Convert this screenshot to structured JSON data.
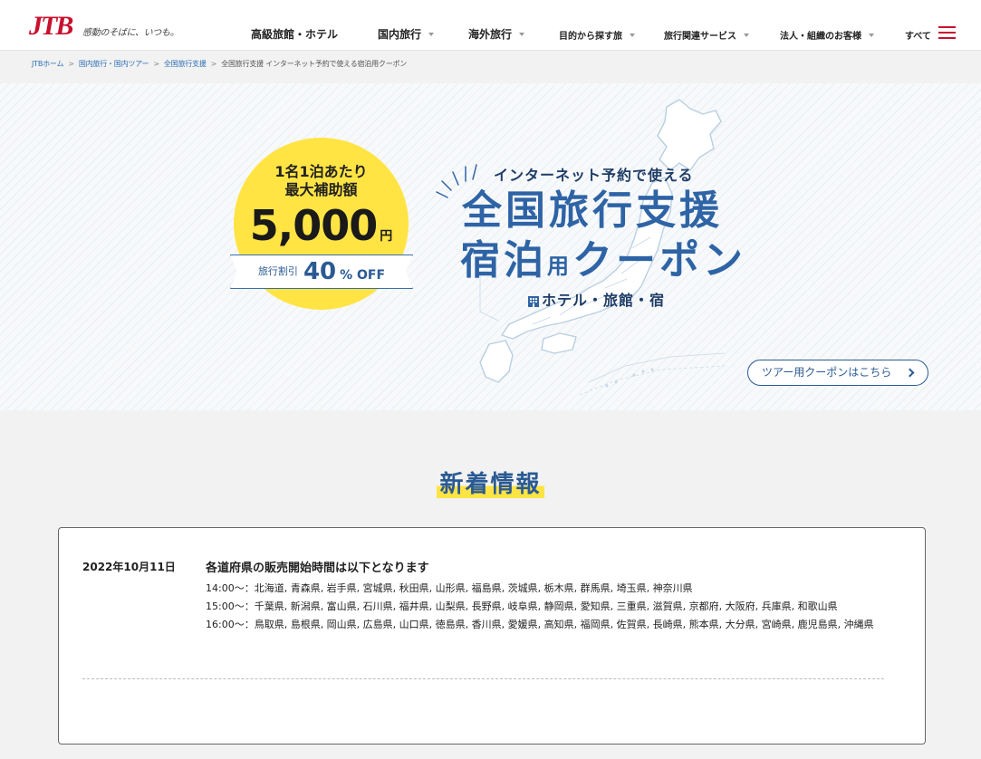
{
  "header": {
    "logo": "JTB",
    "tagline": "感動のそばに、いつも。",
    "nav": [
      {
        "label": "高級旅館・ホテル"
      },
      {
        "label": "国内旅行"
      },
      {
        "label": "海外旅行"
      },
      {
        "label": "目的から探す旅"
      },
      {
        "label": "旅行関連サービス"
      },
      {
        "label": "法人・組織のお客様"
      },
      {
        "label": "すべて"
      }
    ]
  },
  "breadcrumb": [
    "JTBホーム",
    "国内旅行・国内ツアー",
    "全国旅行支援",
    "全国旅行支援 インターネット予約で使える宿泊用クーポン"
  ],
  "hero": {
    "badge": {
      "line1": "1名1泊あたり",
      "line2": "最大補助額",
      "amount": "5,000",
      "currency": "円",
      "discount_label": "旅行割引",
      "discount_value": "40",
      "discount_unit": "% OFF"
    },
    "subtitle": "インターネット予約で使える",
    "title_line1": "全国旅行支援",
    "title_line2_a": "宿泊",
    "title_line2_b": "用",
    "title_line2_c": "クーポン",
    "hotels_label": "ホテル・旅館・宿",
    "tour_coupon_button": "ツアー用クーポンはこちら"
  },
  "news": {
    "heading": "新着情報",
    "items": [
      {
        "date": "2022年10月11日",
        "title": "各道府県の販売開始時間は以下となります",
        "lines": [
          "14:00〜：北海道, 青森県, 岩手県, 宮城県, 秋田県, 山形県, 福島県, 茨城県, 栃木県, 群馬県, 埼玉県, 神奈川県",
          "15:00〜：千葉県, 新潟県, 富山県, 石川県, 福井県, 山梨県, 長野県, 岐阜県, 静岡県, 愛知県, 三重県, 滋賀県, 京都府, 大阪府, 兵庫県, 和歌山県",
          "16:00〜：鳥取県, 島根県, 岡山県, 広島県, 山口県, 徳島県, 香川県, 愛媛県, 高知県, 福岡県, 佐賀県, 長崎県, 熊本県, 大分県, 宮崎県, 鹿児島県, 沖縄県"
        ]
      }
    ]
  },
  "colors": {
    "brand_red": "#c8102e",
    "accent_blue": "#2e64a5",
    "highlight_yellow": "#ffe444"
  }
}
